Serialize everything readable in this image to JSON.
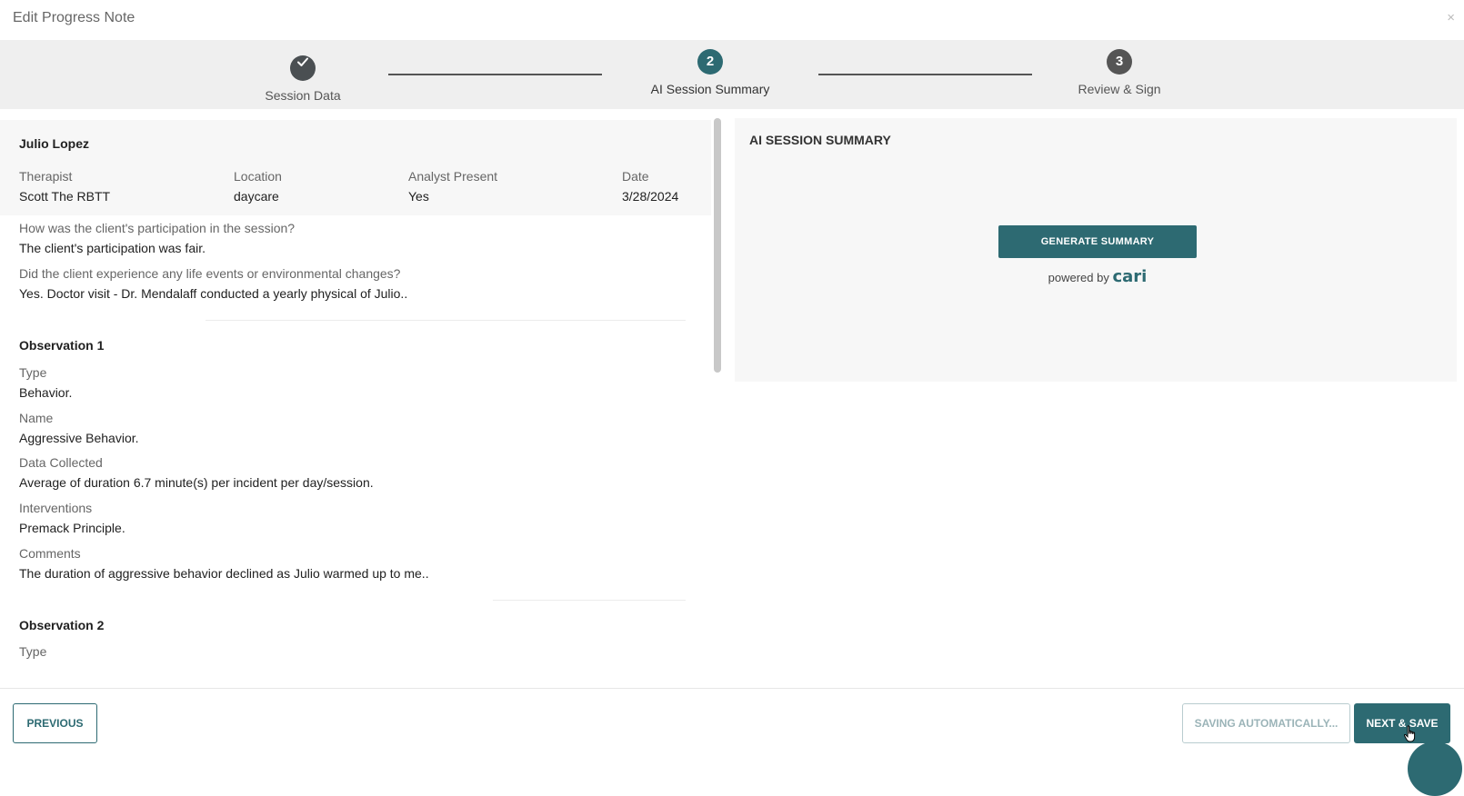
{
  "window": {
    "title": "Edit Progress Note",
    "close_glyph": "×"
  },
  "stepper": {
    "steps": [
      {
        "number": "✓",
        "label": "Session Data",
        "state": "completed",
        "color": "#4a4f52"
      },
      {
        "number": "2",
        "label": "AI Session Summary",
        "state": "active",
        "color": "#2d6a72"
      },
      {
        "number": "3",
        "label": "Review & Sign",
        "state": "upcoming",
        "color": "#555555"
      }
    ]
  },
  "client": {
    "name": "Julio Lopez",
    "info": [
      {
        "label": "Therapist",
        "value": "Scott The RBTT"
      },
      {
        "label": "Location",
        "value": "daycare"
      },
      {
        "label": "Analyst Present",
        "value": "Yes"
      },
      {
        "label": "Date",
        "value": "3/28/2024"
      }
    ]
  },
  "questions": [
    {
      "q": "How was the client's participation in the session?",
      "a": "The client's participation was fair."
    },
    {
      "q": "Did the client experience any life events or environmental changes?",
      "a": "Yes. Doctor visit - Dr. Mendalaff conducted a yearly physical of Julio.."
    }
  ],
  "observations": [
    {
      "title": "Observation 1",
      "fields": [
        {
          "label": "Type",
          "value": "Behavior."
        },
        {
          "label": "Name",
          "value": "Aggressive Behavior."
        },
        {
          "label": "Data Collected",
          "value": "Average of duration 6.7 minute(s) per incident per day/session."
        },
        {
          "label": "Interventions",
          "value": "Premack Principle."
        },
        {
          "label": "Comments",
          "value": "The duration of aggressive behavior declined as Julio warmed up to me.."
        }
      ]
    },
    {
      "title": "Observation 2",
      "fields": [
        {
          "label": "Type",
          "value": ""
        }
      ]
    }
  ],
  "ai_summary": {
    "heading": "AI SESSION SUMMARY",
    "generate_label": "GENERATE SUMMARY",
    "powered_by": "powered by",
    "brand": "cari"
  },
  "footer": {
    "previous_label": "PREVIOUS",
    "saving_label": "SAVING AUTOMATICALLY...",
    "next_label": "NEXT & SAVE"
  },
  "colors": {
    "accent": "#2d6a72",
    "stepper_bg": "#efefef",
    "card_bg": "#f7f7f7"
  }
}
